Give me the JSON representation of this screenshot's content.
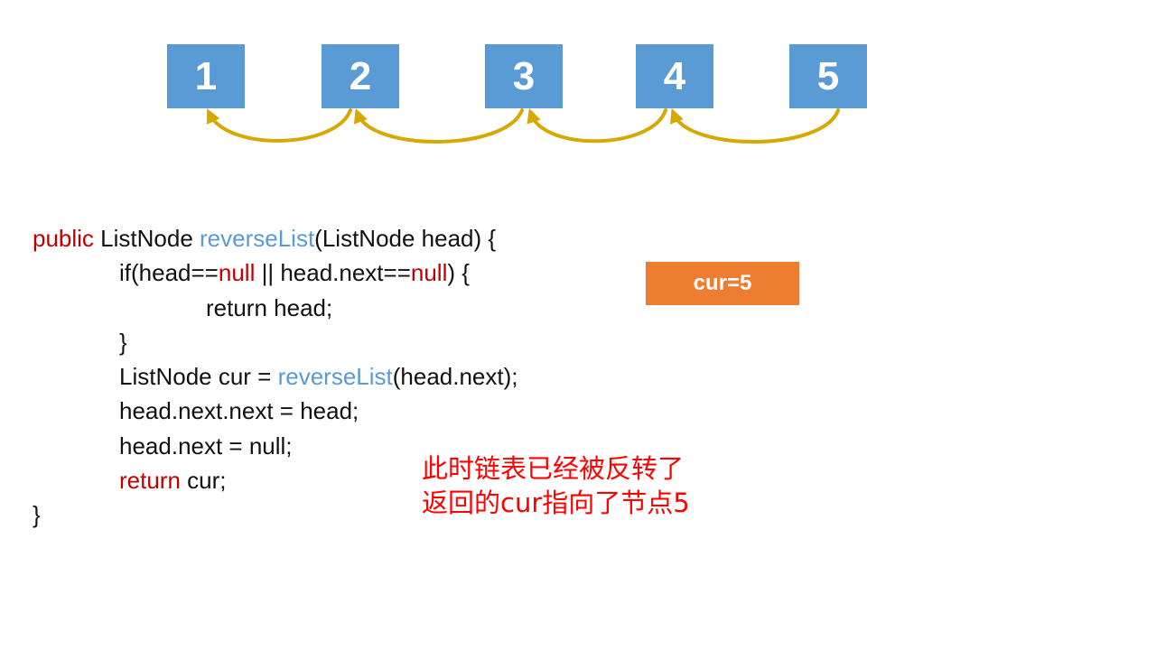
{
  "nodes": [
    "1",
    "2",
    "3",
    "4",
    "5"
  ],
  "code": {
    "l1": {
      "a": "public",
      "b": " ListNode ",
      "c": "reverseList",
      "d": "(ListNode head) {"
    },
    "l2": {
      "a": "if(head==",
      "b": "null",
      "c": " || head.next==",
      "d": "null",
      "e": ") {"
    },
    "l3": "return head;",
    "l4": "}",
    "l5": {
      "a": "ListNode cur = ",
      "b": "reverseList",
      "c": "(head.next);"
    },
    "l6": "head.next.next = head;",
    "l7": "head.next = null;",
    "l8": {
      "a": "return",
      "b": " cur;"
    },
    "l9": "}"
  },
  "badge": "cur=5",
  "note": [
    "此时链表已经被反转了",
    "返回的cur指向了节点5"
  ],
  "colors": {
    "node": "#5b9bd5",
    "arrow": "#d6a800",
    "badge": "#ed7d31",
    "keyword": "#c00000",
    "method": "#5b9bd5",
    "note": "#ff0000"
  }
}
